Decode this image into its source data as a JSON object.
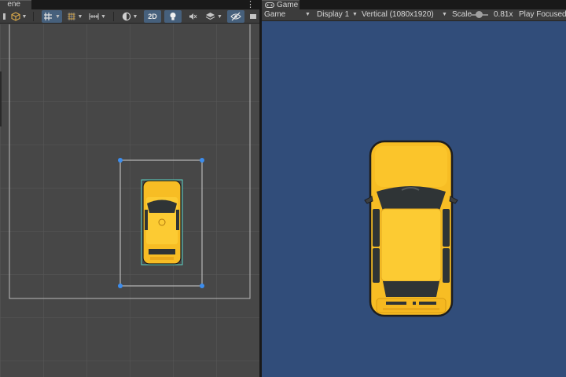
{
  "scene": {
    "tab_label": "ene",
    "toolbar": {
      "mode_2d_label": "2D"
    }
  },
  "game": {
    "tab_label": "Game",
    "toolbar": {
      "view_mode": "Game",
      "display": "Display 1",
      "resolution": "Vertical (1080x1920)",
      "scale_label": "Scale",
      "scale_value": "0.81x",
      "play_mode": "Play Focused"
    },
    "background_color": "#314d7a"
  },
  "colors": {
    "car_body": "#f7bd24",
    "car_roof": "#fccb33",
    "car_outline": "#1d1d1d",
    "car_window": "#2f3436",
    "gizmo_handle": "#3c8dee",
    "selection_outline": "#5bd4c7"
  },
  "icons": {
    "panel_menu": "more-vert-icon",
    "game_tab": "game-controller-icon"
  }
}
